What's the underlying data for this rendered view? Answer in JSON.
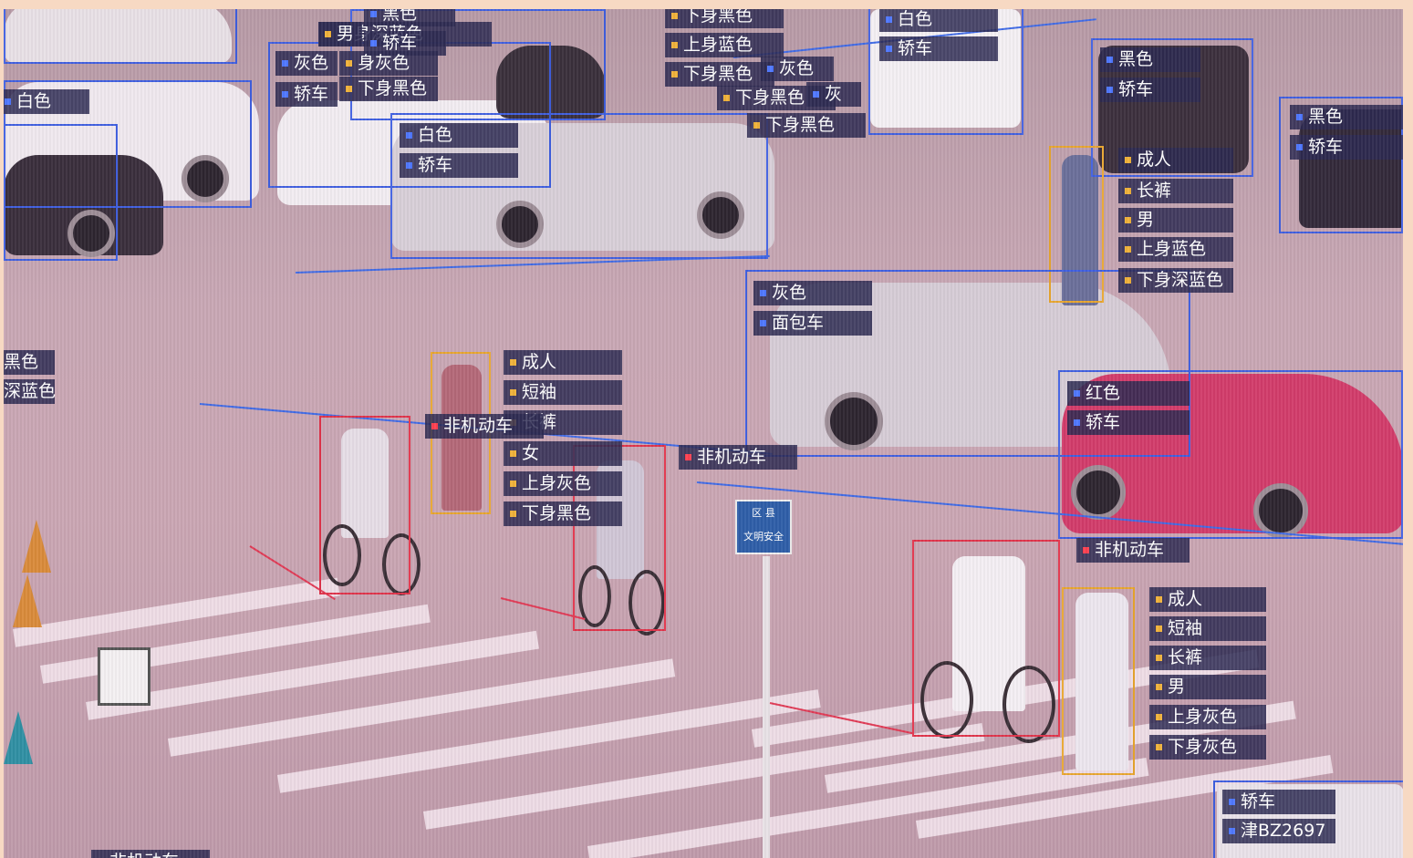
{
  "tags": {
    "c1": [
      "黑色",
      "下身深蓝色"
    ],
    "c2": [
      "男",
      "轿车"
    ],
    "c3": [
      "灰色",
      "身灰色"
    ],
    "c4": [
      "轿车",
      "下身黑色"
    ],
    "c5": [
      "白色"
    ],
    "c6": [
      "白色",
      "轿车"
    ],
    "c7": [
      "下身黑色",
      "上身蓝色",
      "下身黑色",
      "灰色",
      "下身黑色",
      "灰",
      "下身黑色"
    ],
    "c8": [
      "白色",
      "轿车"
    ],
    "c9": [
      "黑色",
      "轿车"
    ],
    "c10": [
      "黑色",
      "轿车"
    ],
    "p1": [
      "成人",
      "长裤",
      "男",
      "上身蓝色",
      "下身深蓝色"
    ],
    "c11": [
      "灰色",
      "面包车"
    ],
    "left_cut": [
      "黑色",
      "深蓝色"
    ],
    "p2": [
      "成人",
      "短袖",
      "长裤",
      "女",
      "上身灰色",
      "下身黑色"
    ],
    "nmv1": [
      "非机动车"
    ],
    "nmv2": [
      "非机动车"
    ],
    "c12": [
      "红色",
      "轿车"
    ],
    "nmv3": [
      "非机动车"
    ],
    "p3": [
      "成人",
      "短袖",
      "长裤",
      "男",
      "上身灰色",
      "下身灰色"
    ],
    "c13": [
      "轿车",
      "津BZ2697"
    ],
    "nmv4": [
      "非机动车"
    ]
  },
  "sign": {
    "line1": "区 县",
    "line2": "文明安全"
  },
  "colors": {
    "frame": "#f7d9c3",
    "box_blue": "#3f5fe0",
    "box_red": "#e0334a",
    "box_yellow": "#e8a62e",
    "tag_bg": "#2c2a52"
  }
}
